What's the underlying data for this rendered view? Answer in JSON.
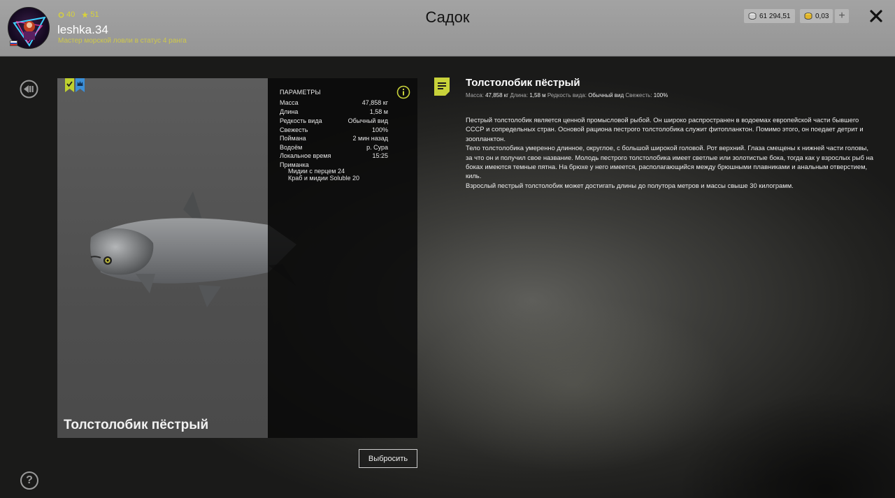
{
  "header": {
    "title": "Садок",
    "player": {
      "name": "leshka.34",
      "rank_text": "Мастер морской ловли в статус 4 ранга",
      "stat_a": "40",
      "stat_b": "51"
    },
    "currency": {
      "silver": "61 294,51",
      "gold": "0,03"
    }
  },
  "card": {
    "fish_name": "Толстолобик пёстрый"
  },
  "params": {
    "title": "ПАРАМЕТРЫ",
    "rows": [
      {
        "label": "Масса",
        "value": "47,858 кг"
      },
      {
        "label": "Длина",
        "value": "1,58 м"
      },
      {
        "label": "Редкость вида",
        "value": "Обычный вид"
      },
      {
        "label": "Свежесть",
        "value": "100%"
      },
      {
        "label": "Поймана",
        "value": "2 мин назад"
      },
      {
        "label": "Водоём",
        "value": "р. Сура"
      },
      {
        "label": "Локальное время",
        "value": "15:25"
      }
    ],
    "bait_label": "Приманка",
    "baits": [
      "Мидии с перцем 24",
      "Краб и мидии Soluble 20"
    ]
  },
  "actions": {
    "discard_label": "Выбросить"
  },
  "description": {
    "title": "Толстолобик пёстрый",
    "meta": {
      "mass_label": "Масса:",
      "mass_value": "47,858 кг",
      "length_label": "Длина:",
      "length_value": "1,58 м",
      "rarity_label": "Редкость вида:",
      "rarity_value": "Обычный вид",
      "fresh_label": "Свежесть:",
      "fresh_value": "100%"
    },
    "paragraphs": [
      "Пестрый толстолобик является ценной промысловой рыбой. Он широко распространен в водоемах европейской части бывшего СССР и сопредельных стран. Основой рациона пестрого толстолобика служит фитопланктон. Помимо этого, он поедает детрит и зоопланктон.",
      "Тело толстолобика умеренно длинное, округлое, с большой широкой головой. Рот верхний. Глаза смещены к нижней части головы, за что он и получил свое название. Молодь пестрого толстолобика имеет светлые или золотистые бока, тогда как у взрослых рыб на боках имеются темные пятна. На брюхе у него имеется, располагающийся между брюшными плавниками и анальным отверстием, киль.",
      "Взрослый пестрый толстолобик может достигать длины до полутора метров и массы свыше 30 килограмм."
    ]
  },
  "colors": {
    "accent_yellow": "#c8d23a",
    "badge_blue": "#3b8fd8",
    "topbar_bg": "#9b9b9b"
  },
  "icons": [
    "avatar",
    "flag-ru-icon",
    "coin-silver-icon",
    "coin-gold-icon",
    "plus-icon",
    "close-icon",
    "back-icon",
    "help-icon",
    "badge-check-icon",
    "badge-crown-icon",
    "info-icon",
    "note-icon"
  ]
}
